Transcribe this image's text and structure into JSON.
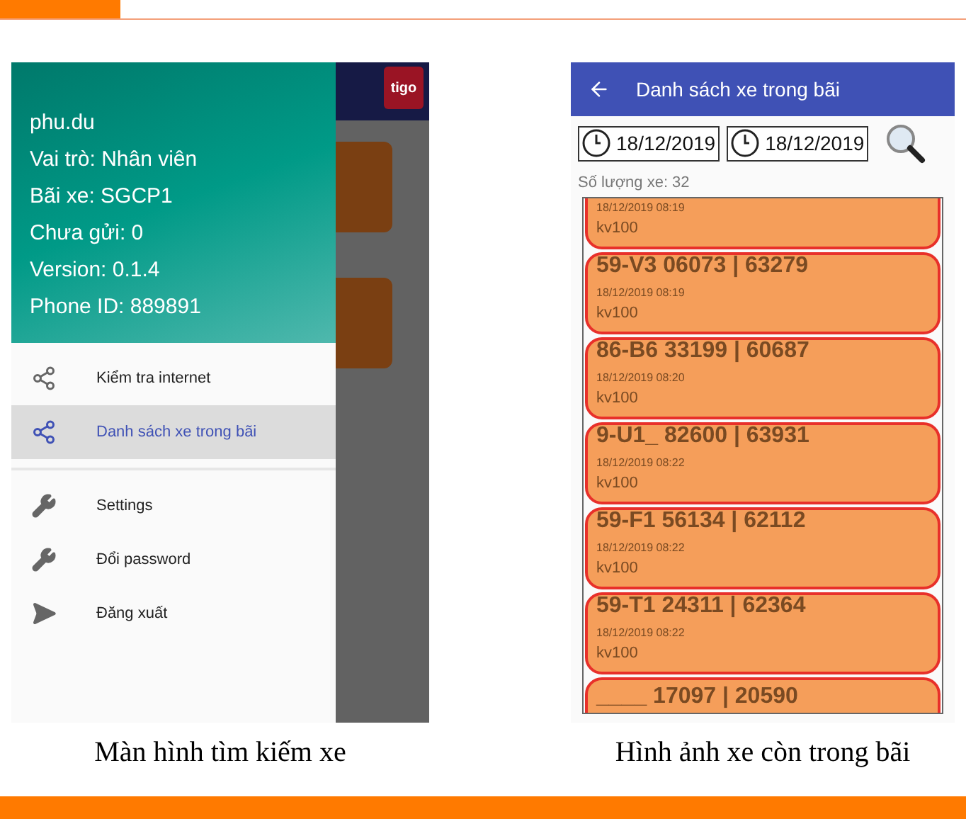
{
  "left_screen": {
    "drawer_header": {
      "username": "phu.du",
      "lines": [
        "Vai trò: Nhân viên",
        "Bãi xe: SGCP1",
        "Chưa gửi: 0",
        "Version: 0.1.4",
        "Phone ID: 889891"
      ]
    },
    "menu_sections": [
      [
        {
          "label": "Kiểm tra internet",
          "selected": false
        },
        {
          "label": "Danh sách xe trong bãi",
          "selected": true
        }
      ],
      [
        {
          "label": "Settings",
          "selected": false
        },
        {
          "label": "Đổi password",
          "selected": false
        },
        {
          "label": "Đăng xuất",
          "selected": false
        }
      ]
    ],
    "background_app": {
      "logo": "tigo"
    },
    "caption": "Màn hình tìm kiếm xe"
  },
  "right_screen": {
    "app_bar": {
      "title": "Danh sách xe trong bãi"
    },
    "date_from": "18/12/2019",
    "date_to": "18/12/2019",
    "count": "Số lượng xe: 32",
    "vehicles": [
      {
        "time": "18/12/2019 08:19",
        "code": "kv100"
      },
      {
        "title": "59-V3 06073 | 63279",
        "time": "18/12/2019 08:19",
        "code": "kv100"
      },
      {
        "title": "86-B6 33199 | 60687",
        "time": "18/12/2019 08:20",
        "code": "kv100"
      },
      {
        "title": "9-U1_ 82600 | 63931",
        "time": "18/12/2019 08:22",
        "code": "kv100"
      },
      {
        "title": "59-F1 56134 | 62112",
        "time": "18/12/2019 08:22",
        "code": "kv100"
      },
      {
        "title": "59-T1 24311 | 62364",
        "time": "18/12/2019 08:22",
        "code": "kv100"
      },
      {
        "title": "____ 17097 | 20590"
      }
    ],
    "caption": "Hình ảnh xe còn trong bãi"
  }
}
